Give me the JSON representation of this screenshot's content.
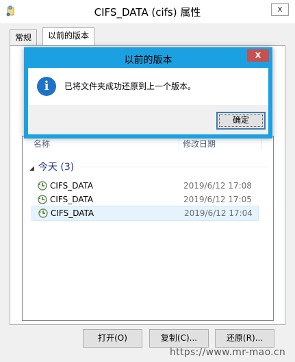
{
  "window": {
    "title": "CIFS_DATA (cifs) 属性",
    "close_label": "x"
  },
  "tabs": [
    {
      "label": "常规"
    },
    {
      "label": "以前的版本"
    }
  ],
  "list": {
    "columns": {
      "name": "名称",
      "date": "修改日期"
    },
    "group": {
      "label": "今天 (3)"
    },
    "rows": [
      {
        "name": "CIFS_DATA",
        "date": "2019/6/12 17:08"
      },
      {
        "name": "CIFS_DATA",
        "date": "2019/6/12 17:05"
      },
      {
        "name": "CIFS_DATA",
        "date": "2019/6/12 17:04"
      }
    ]
  },
  "buttons": {
    "open": "打开(O)",
    "copy": "复制(C)...",
    "restore": "还原(R)..."
  },
  "dialog": {
    "title": "以前的版本",
    "close_label": "x",
    "message": "已将文件夹成功还原到上一个版本。",
    "ok_label": "确定",
    "accent_color": "#1ba1e2",
    "icon": "info-icon"
  },
  "watermark": "https://www.mr-mao.cn"
}
